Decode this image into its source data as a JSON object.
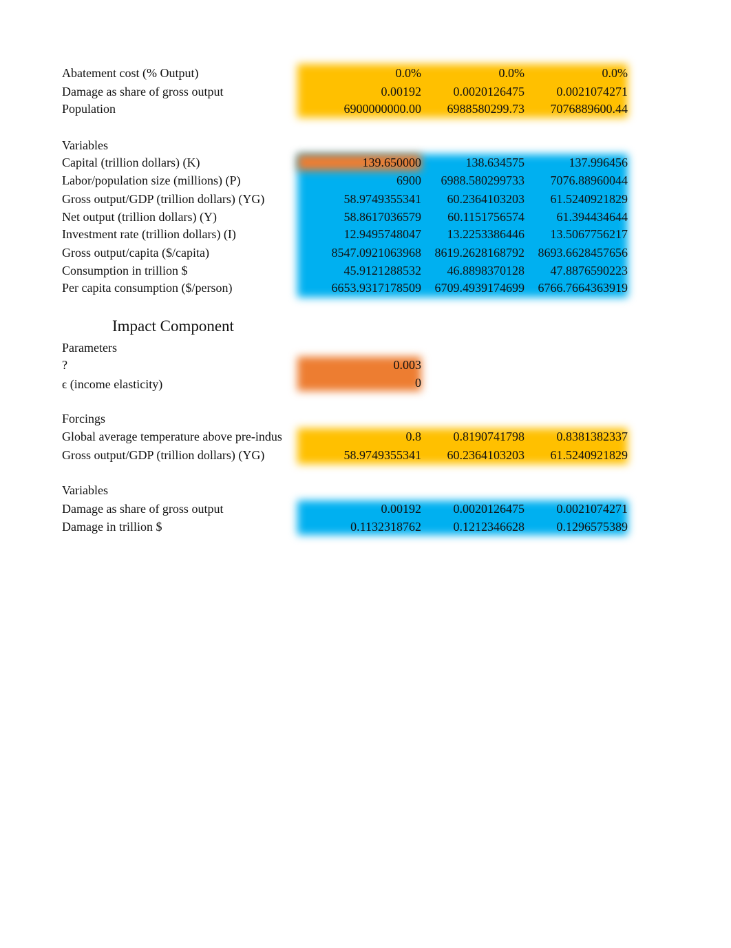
{
  "economic": {
    "parameters": [
      {
        "label": "Abatement cost (% Output)",
        "values": [
          "0.0%",
          "0.0%",
          "0.0%"
        ]
      },
      {
        "label": "Damage as share of gross output",
        "values": [
          "0.00192",
          "0.0020126475",
          "0.0021074271"
        ]
      },
      {
        "label": "Population",
        "values": [
          "6900000000.00",
          "6988580299.73",
          "7076889600.44"
        ]
      }
    ],
    "variables_heading": "Variables",
    "variables": [
      {
        "label": "Capital (trillion dollars) (K)",
        "values": [
          "139.650000",
          "138.634575",
          "137.996456"
        ]
      },
      {
        "label": "Labor/population size (millions) (P)",
        "values": [
          "6900",
          "6988.580299733",
          "7076.88960044"
        ]
      },
      {
        "label": "Gross output/GDP (trillion dollars) (YG)",
        "values": [
          "58.9749355341",
          "60.2364103203",
          "61.5240921829"
        ]
      },
      {
        "label": "Net output (trillion dollars) (Y)",
        "values": [
          "58.8617036579",
          "60.1151756574",
          "61.394434644"
        ]
      },
      {
        "label": "Investment rate (trillion dollars) (I)",
        "values": [
          "12.9495748047",
          "13.2253386446",
          "13.5067756217"
        ]
      },
      {
        "label": "Gross output/capita ($/capita)",
        "values": [
          "8547.0921063968",
          "8619.2628168792",
          "8693.6628457656"
        ]
      },
      {
        "label": "Consumption in trillion $",
        "values": [
          "45.9121288532",
          "46.8898370128",
          "47.8876590223"
        ]
      },
      {
        "label": "Per capita consumption ($/person)",
        "values": [
          "6653.9317178509",
          "6709.4939174699",
          "6766.7664363919"
        ]
      }
    ]
  },
  "impact": {
    "title": "Impact Component",
    "parameters_heading": "Parameters",
    "parameters": [
      {
        "label": "?",
        "values": [
          "0.003"
        ]
      },
      {
        "label": "ϵ (income elasticity)",
        "values": [
          "0"
        ]
      }
    ],
    "forcings_heading": "Forcings",
    "forcings": [
      {
        "label": "Global average temperature above pre-indus",
        "values": [
          "0.8",
          "0.8190741798",
          "0.8381382337"
        ]
      },
      {
        "label": "Gross output/GDP (trillion dollars) (YG)",
        "values": [
          "58.9749355341",
          "60.2364103203",
          "61.5240921829"
        ]
      }
    ],
    "variables_heading": "Variables",
    "variables": [
      {
        "label": "Damage as share of gross output",
        "values": [
          "0.00192",
          "0.0020126475",
          "0.0021074271"
        ]
      },
      {
        "label": "Damage in trillion $",
        "values": [
          "0.1132318762",
          "0.1212346628",
          "0.1296575389"
        ]
      }
    ]
  },
  "colors": {
    "input_yellow": "#FFC000",
    "computed_blue": "#00B0F0",
    "initial_orange": "#ED7D31"
  }
}
